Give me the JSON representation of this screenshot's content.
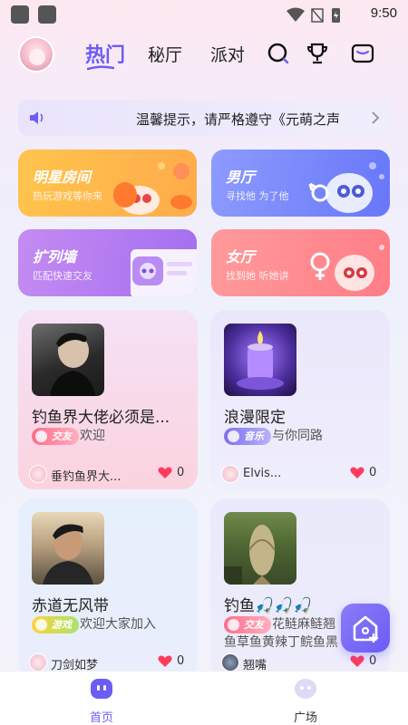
{
  "status_bar": {
    "time": "9:50"
  },
  "header": {
    "tabs": [
      {
        "label": "热门",
        "active": true
      },
      {
        "label": "秘厅",
        "active": false
      },
      {
        "label": "派对",
        "active": false
      }
    ],
    "icons": [
      "search-icon",
      "trophy-icon",
      "mail-icon"
    ]
  },
  "notice": {
    "text": "温馨提示，请严格遵守《元萌之声"
  },
  "categories": [
    {
      "title": "明星房间",
      "subtitle": "热玩游戏等你来"
    },
    {
      "title": "男厅",
      "subtitle": "寻找他 为了他"
    },
    {
      "title": "扩列墙",
      "subtitle": "匹配快速交友"
    },
    {
      "title": "女厅",
      "subtitle": "找到她 听她讲"
    }
  ],
  "rooms": [
    {
      "title": "钓鱼界大佬必须是...",
      "tag": "交友",
      "desc": "欢迎",
      "desc2": "",
      "owner": "垂钓鱼界大...",
      "likes": "0"
    },
    {
      "title": "浪漫限定",
      "tag": "音乐",
      "desc": "与你同路",
      "desc2": "",
      "owner": "Elvis...",
      "likes": "0"
    },
    {
      "title": "赤道无风带",
      "tag": "游戏",
      "desc": "欢迎大家加入",
      "desc2": "",
      "owner": "刀剑如梦",
      "likes": "0"
    },
    {
      "title": "钓鱼🎣🎣🎣",
      "tag": "交友",
      "desc": "花鲢麻鲢翘",
      "desc2": "鱼草鱼黄辣丁鲩鱼黑",
      "owner": "翘嘴",
      "likes": "0"
    }
  ],
  "bottom_nav": [
    {
      "label": "首页",
      "active": true
    },
    {
      "label": "广场",
      "active": false
    }
  ],
  "colors": {
    "accent": "#6b5cf6",
    "heart": "#ff3b5c"
  }
}
